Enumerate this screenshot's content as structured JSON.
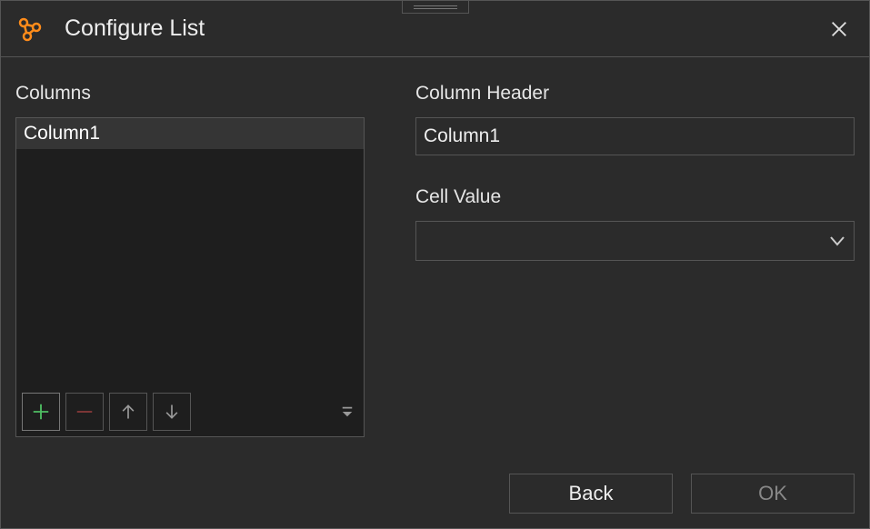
{
  "titlebar": {
    "title": "Configure List"
  },
  "left": {
    "label": "Columns",
    "items": [
      "Column1"
    ]
  },
  "right": {
    "header_label": "Column Header",
    "header_value": "Column1",
    "cellvalue_label": "Cell Value",
    "cellvalue_value": ""
  },
  "footer": {
    "back": "Back",
    "ok": "OK"
  }
}
